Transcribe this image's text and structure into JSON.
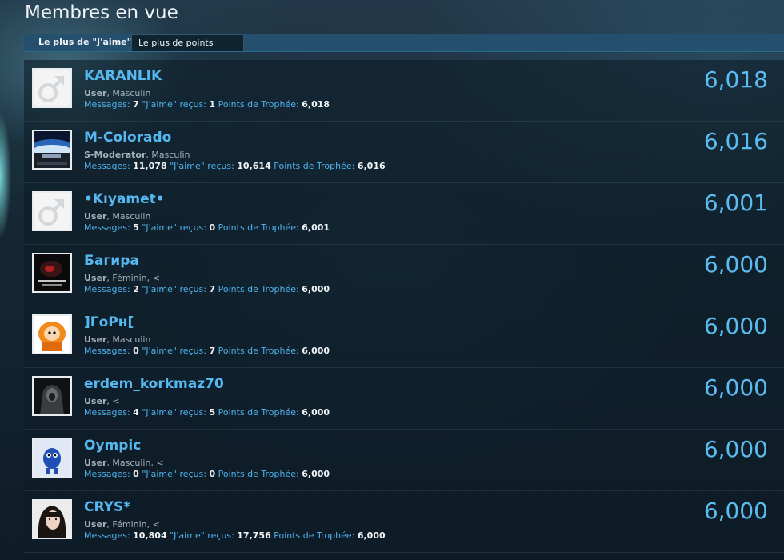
{
  "title": "Membres en vue",
  "tabs": [
    {
      "label": "Le plus de \"J'aime\""
    },
    {
      "label": "Le plus de points"
    }
  ],
  "labels": {
    "messages": "Messages:",
    "likes": "\"J'aime\" reçus:",
    "trophy": "Points de Trophée:"
  },
  "members": [
    {
      "name": "KARANLIK",
      "role": "User",
      "extra": ", Masculin",
      "messages": "7",
      "likes": "1",
      "points": "6,018",
      "score": "6,018",
      "avatar": "male-default-icon"
    },
    {
      "name": "M-Colorado",
      "role": "S-Moderator",
      "extra": ", Masculin",
      "messages": "11,078",
      "likes": "10,614",
      "points": "6,016",
      "score": "6,016",
      "avatar": "smoderator-badge-image"
    },
    {
      "name": "•Kıyamet•",
      "role": "User",
      "extra": ", Masculin",
      "messages": "5",
      "likes": "0",
      "points": "6,001",
      "score": "6,001",
      "avatar": "male-default-icon"
    },
    {
      "name": "Багира",
      "role": "User",
      "extra": ", Féminin, <",
      "messages": "2",
      "likes": "7",
      "points": "6,000",
      "score": "6,000",
      "avatar": "dark-creature-image"
    },
    {
      "name": "]ГоРн[",
      "role": "User",
      "extra": ", Masculin",
      "messages": "0",
      "likes": "7",
      "points": "6,000",
      "score": "6,000",
      "avatar": "cartoon-character-image"
    },
    {
      "name": "erdem_korkmaz70",
      "role": "User",
      "extra": ", <",
      "messages": "4",
      "likes": "5",
      "points": "6,000",
      "score": "6,000",
      "avatar": "hooded-figure-image"
    },
    {
      "name": "Oympic",
      "role": "User",
      "extra": ", Masculin, <",
      "messages": "0",
      "likes": "0",
      "points": "6,000",
      "score": "6,000",
      "avatar": "blue-candy-character-image"
    },
    {
      "name": "CRYS*",
      "role": "User",
      "extra": ", Féminin, <",
      "messages": "10,804",
      "likes": "17,756",
      "points": "6,000",
      "score": "6,000",
      "avatar": "woman-portrait-image"
    }
  ],
  "colors": {
    "accent": "#56b8f0",
    "tab_bar": "#24506e",
    "text_light": "#f0f3f5"
  }
}
